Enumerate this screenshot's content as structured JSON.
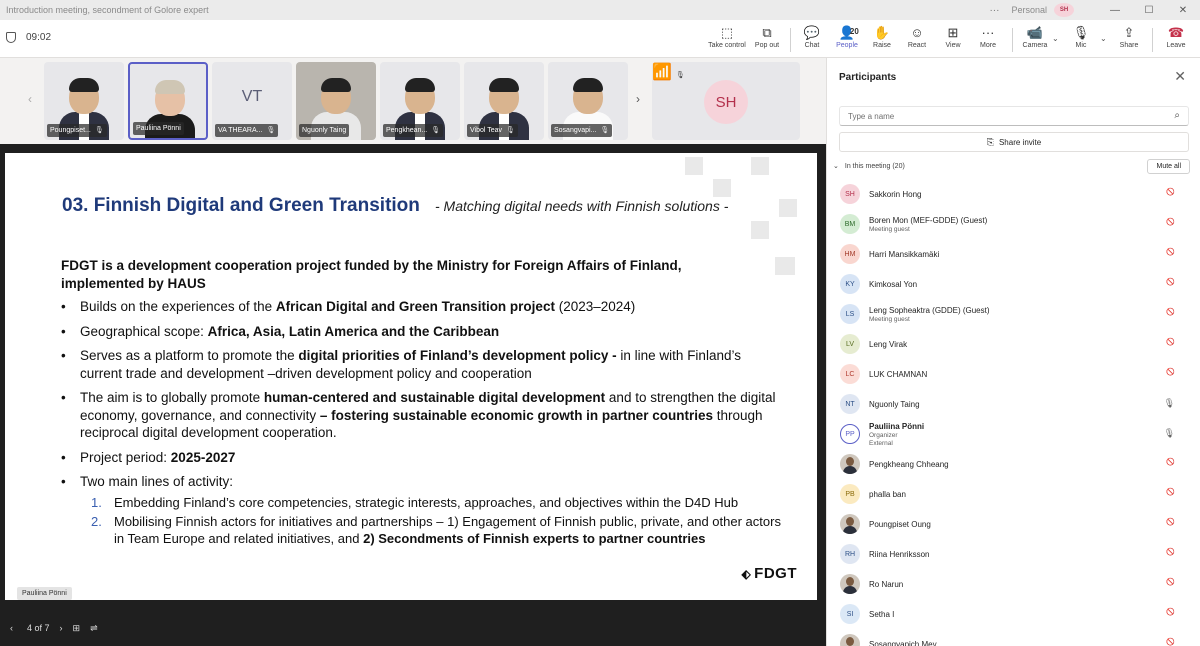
{
  "window": {
    "title": "Introduction meeting, secondment of Golore expert",
    "profile": "Personal",
    "profile_initials": "SH",
    "more": "···"
  },
  "toolbar": {
    "timer": "09:02",
    "items": [
      {
        "label": "Take control",
        "icon": "take-control-icon"
      },
      {
        "label": "Pop out",
        "icon": "pop-out-icon"
      },
      {
        "label": "Chat",
        "icon": "chat-icon"
      },
      {
        "label": "People",
        "icon": "people-icon",
        "count": "20"
      },
      {
        "label": "Raise",
        "icon": "raise-hand-icon"
      },
      {
        "label": "React",
        "icon": "react-icon"
      },
      {
        "label": "View",
        "icon": "view-icon"
      },
      {
        "label": "More",
        "icon": "more-icon"
      },
      {
        "label": "Camera",
        "icon": "camera-icon"
      },
      {
        "label": "Mic",
        "icon": "mic-icon"
      },
      {
        "label": "Share",
        "icon": "share-icon"
      },
      {
        "label": "Leave",
        "icon": "leave-icon"
      }
    ]
  },
  "strip": {
    "tiles": [
      {
        "name": "Poungpiset...",
        "type": "photo"
      },
      {
        "name": "Pauliina Pönni",
        "type": "photo",
        "active": true
      },
      {
        "name": "VA THEARA...",
        "initials": "VT"
      },
      {
        "name": "Nguonly Taing",
        "type": "photo"
      },
      {
        "name": "Pengkhean...",
        "type": "photo"
      },
      {
        "name": "Vibol Teav",
        "type": "photo"
      },
      {
        "name": "Sosangvapi...",
        "type": "photo"
      }
    ],
    "self_initials": "SH"
  },
  "slide": {
    "title": "03. Finnish Digital and Green Transition",
    "subtitle": "- Matching digital needs with Finnish solutions -",
    "lead": "FDGT is a development cooperation project funded by the Ministry for Foreign Affairs of Finland, implemented by HAUS",
    "b1_pre": "Builds on the experiences of the ",
    "b1_bold": "African Digital and Green Transition project",
    "b1_post": " (2023–2024)",
    "b2_pre": "Geographical scope: ",
    "b2_bold": "Africa, Asia, Latin America and the Caribbean",
    "b3_pre": "Serves as a platform to promote the ",
    "b3_bold": "digital priorities of Finland’s development policy -",
    "b3_post": " in line with Finland’s current trade and development –driven development policy and cooperation",
    "b4_pre": "The aim is to globally promote ",
    "b4_bold1": "human-centered and sustainable digital development",
    "b4_mid": " and to strengthen the digital economy, governance, and connectivity ",
    "b4_bold2": "– fostering sustainable economic growth in partner countries",
    "b4_post": " through reciprocal digital development cooperation.",
    "b5_pre": "Project period: ",
    "b5_bold": "2025-2027",
    "b6": "Two main lines of activity:",
    "n1_num": "1.",
    "n1": "Embedding Finland’s core competencies, strategic interests, approaches, and objectives within the D4D Hub",
    "n2_num": "2.",
    "n2_pre": "Mobilising Finnish actors for initiatives and partnerships – 1) Engagement of Finnish public, private, and other actors in Team Europe and related initiatives, and ",
    "n2_bold": "2) Secondments of Finnish experts to partner countries",
    "logo": "FDGT",
    "bullet_char": "•"
  },
  "presenter": "Pauliina Pönni",
  "slide_nav": {
    "page": "4 of 7"
  },
  "panel": {
    "title": "Participants",
    "search_placeholder": "Type a name",
    "share_invite": "Share invite",
    "section": "In this meeting (20)",
    "mute_all": "Mute all",
    "participants": [
      {
        "initials": "SH",
        "name": "Sakkorin Hong",
        "bg": "#f6d3da",
        "fg": "#b3304c",
        "mic": "muted"
      },
      {
        "initials": "BM",
        "name": "Boren Mon (MEF-GDDE) (Guest)",
        "role": "Meeting guest",
        "bg": "#d4ecd3",
        "fg": "#2d6a2a",
        "mic": "muted"
      },
      {
        "initials": "HM",
        "name": "Harri Mansikkamäki",
        "bg": "#f9d6cf",
        "fg": "#a33b2a",
        "mic": "muted"
      },
      {
        "initials": "KY",
        "name": "Kimkosal Yon",
        "bg": "#d7e4f5",
        "fg": "#2c4f86",
        "mic": "muted"
      },
      {
        "initials": "LS",
        "name": "Leng Sopheaktra (GDDE) (Guest)",
        "role": "Meeting guest",
        "bg": "#d7e4f5",
        "fg": "#2c4f86",
        "mic": "muted"
      },
      {
        "initials": "LV",
        "name": "Leng Virak",
        "bg": "#e6ecd1",
        "fg": "#556b1e",
        "mic": "muted"
      },
      {
        "initials": "LC",
        "name": "LUK CHAMNAN",
        "bg": "#fbdcd6",
        "fg": "#b03a2e",
        "mic": "muted"
      },
      {
        "initials": "NT",
        "name": "Nguonly Taing",
        "bg": "#dfe6f2",
        "fg": "#2c4f86",
        "mic": "on"
      },
      {
        "initials": "PP",
        "name": "Pauliina Pönni",
        "role": "Organizer",
        "role2": "External",
        "bg": "#ffffff",
        "fg": "#5b5fc7",
        "mic": "on",
        "bold": true
      },
      {
        "initials": "",
        "name": "Pengkheang Chheang",
        "photo": true,
        "mic": "muted"
      },
      {
        "initials": "PB",
        "name": "phalla ban",
        "bg": "#fbeac0",
        "fg": "#8a6a0a",
        "mic": "muted"
      },
      {
        "initials": "",
        "name": "Poungpiset Oung",
        "photo": true,
        "mic": "muted"
      },
      {
        "initials": "RH",
        "name": "Riina Henriksson",
        "bg": "#dfe6f2",
        "fg": "#2c4f86",
        "mic": "muted"
      },
      {
        "initials": "",
        "name": "Ro Narun",
        "photo": true,
        "mic": "muted"
      },
      {
        "initials": "SI",
        "name": "Setha I",
        "bg": "#dbe8f6",
        "fg": "#2c4f86",
        "mic": "muted"
      },
      {
        "initials": "",
        "name": "Sosangvapich Mey",
        "photo": true,
        "mic": "muted"
      }
    ]
  }
}
